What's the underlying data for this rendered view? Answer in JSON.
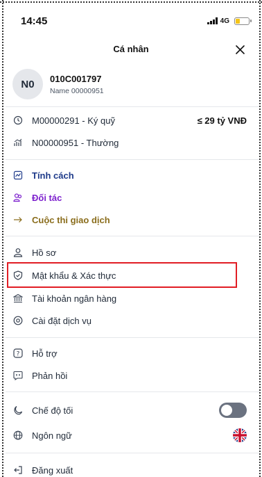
{
  "status_bar": {
    "time": "14:45",
    "network": "4G"
  },
  "header": {
    "title": "Cá nhân"
  },
  "profile": {
    "initials": "N0",
    "code": "010C001797",
    "name": "Name 00000951"
  },
  "accounts": [
    {
      "label": "M00000291 - Ký quỹ",
      "value": "≤ 29 tỷ VNĐ",
      "icon": "clock-icon"
    },
    {
      "label": "N00000951 - Thường",
      "value": "",
      "icon": "chart-icon"
    }
  ],
  "features": [
    {
      "label": "Tính cách",
      "color": "#1e3a8a",
      "icon": "chart-line-icon"
    },
    {
      "label": "Đối tác",
      "color": "#7e22ce",
      "icon": "partners-icon"
    },
    {
      "label": "Cuộc thi giao dịch",
      "color": "#8a6d1c",
      "icon": "arrow-right-icon"
    }
  ],
  "settings": [
    {
      "label": "Hồ sơ",
      "icon": "user-icon"
    },
    {
      "label": "Mật khẩu & Xác thực",
      "icon": "shield-icon"
    },
    {
      "label": "Tài khoản ngân hàng",
      "icon": "bank-icon"
    },
    {
      "label": "Cài đặt dịch vụ",
      "icon": "settings-icon"
    }
  ],
  "support": [
    {
      "label": "Hỗ trợ",
      "icon": "help-icon"
    },
    {
      "label": "Phản hồi",
      "icon": "feedback-icon"
    }
  ],
  "preferences": [
    {
      "label": "Chế độ tối",
      "icon": "moon-icon",
      "dark_mode_on": false
    },
    {
      "label": "Ngôn ngữ",
      "icon": "globe-icon",
      "language_flag": "uk-flag-icon"
    }
  ],
  "logout": {
    "label": "Đăng xuất",
    "icon": "logout-icon"
  },
  "colors": {
    "highlight": "#e11d24",
    "text": "#1f2937"
  }
}
